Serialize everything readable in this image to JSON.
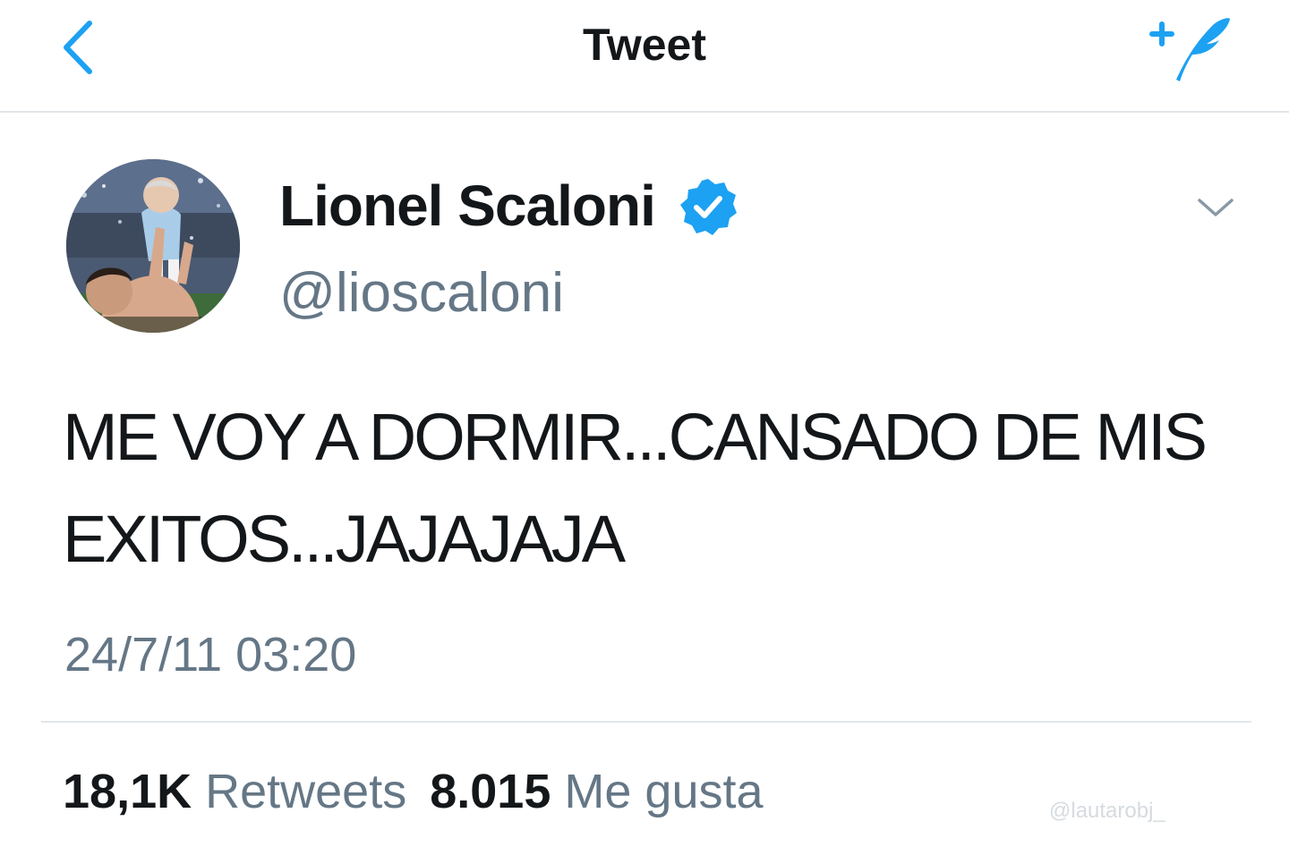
{
  "colors": {
    "accent": "#1da1f2",
    "text_primary": "#14171a",
    "text_secondary": "#657786",
    "divider": "#e1e6ea"
  },
  "nav": {
    "title": "Tweet",
    "back_icon": "chevron-left-icon",
    "compose_icon": "compose-tweet-icon"
  },
  "tweet": {
    "author": {
      "display_name": "Lionel Scaloni",
      "handle": "@lioscaloni",
      "verified": true
    },
    "text": "ME VOY A DORMIR...CANSADO DE MIS EXITOS...JAJAJAJA",
    "timestamp": "24/7/11 03:20",
    "stats": {
      "retweets_count": "18,1K",
      "retweets_label": "Retweets",
      "likes_count": "8.015",
      "likes_label": "Me gusta"
    }
  },
  "watermark": "@lautarobj_"
}
